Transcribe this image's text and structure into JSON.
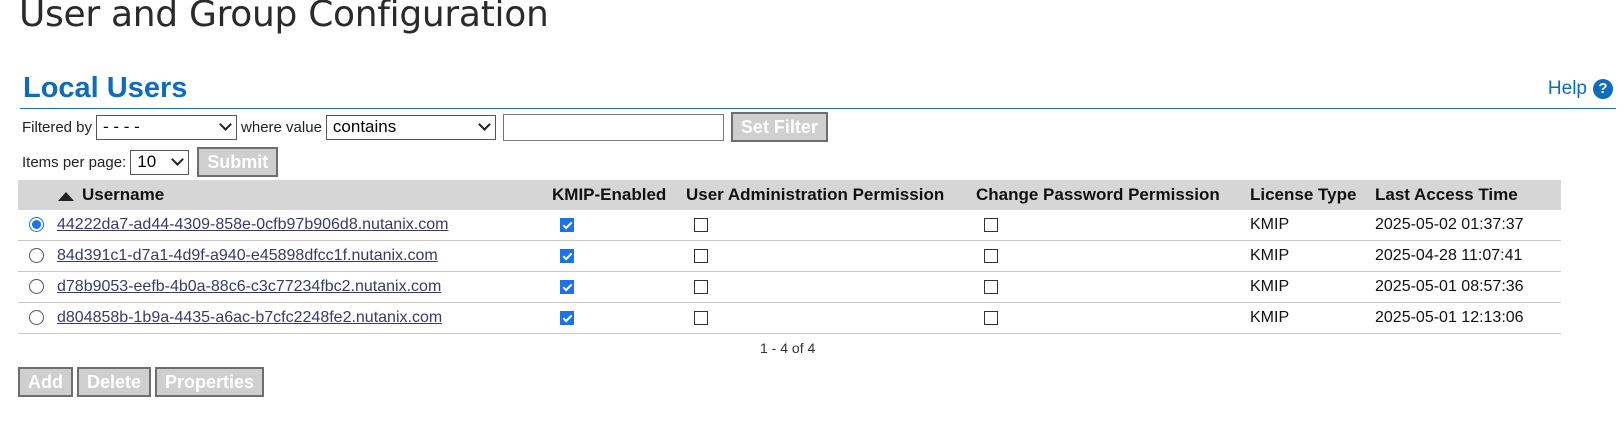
{
  "page": {
    "title": "User and Group Configuration"
  },
  "section": {
    "title": "Local Users",
    "help_label": "Help",
    "help_icon": "?"
  },
  "filter": {
    "filtered_by_label": "Filtered by",
    "filtered_by_value": "- - - -",
    "where_value_label": "where value",
    "condition_value": "contains",
    "text_value": "",
    "set_filter_label": "Set Filter"
  },
  "paging": {
    "items_per_page_label": "Items per page:",
    "items_per_page_value": "10",
    "submit_label": "Submit",
    "range_text": "1 - 4 of 4"
  },
  "table": {
    "sorted_column": "Username",
    "sort_direction": "ascending",
    "columns": {
      "username": "Username",
      "kmip": "KMIP-Enabled",
      "user_admin": "User Administration Permission",
      "change_password": "Change Password Permission",
      "license": "License Type",
      "last_access": "Last Access Time"
    },
    "rows": [
      {
        "selected": true,
        "username": "44222da7-ad44-4309-858e-0cfb97b906d8.nutanix.com",
        "kmip_enabled": true,
        "user_admin": false,
        "change_password": false,
        "license": "KMIP",
        "last_access": "2025-05-02 01:37:37"
      },
      {
        "selected": false,
        "username": "84d391c1-d7a1-4d9f-a940-e45898dfcc1f.nutanix.com",
        "kmip_enabled": true,
        "user_admin": false,
        "change_password": false,
        "license": "KMIP",
        "last_access": "2025-04-28 11:07:41"
      },
      {
        "selected": false,
        "username": "d78b9053-eefb-4b0a-88c6-c3c77234fbc2.nutanix.com",
        "kmip_enabled": true,
        "user_admin": false,
        "change_password": false,
        "license": "KMIP",
        "last_access": "2025-05-01 08:57:36"
      },
      {
        "selected": false,
        "username": "d804858b-1b9a-4435-a6ac-b7cfc2248fe2.nutanix.com",
        "kmip_enabled": true,
        "user_admin": false,
        "change_password": false,
        "license": "KMIP",
        "last_access": "2025-05-01 12:13:06"
      }
    ]
  },
  "actions": {
    "add_label": "Add",
    "delete_label": "Delete",
    "properties_label": "Properties"
  },
  "colors": {
    "brand_blue": "#0f6cbd",
    "header_bg": "#d6d6d6",
    "disabled_button_bg": "#cfcfcf",
    "checkbox_checked": "#1a73e8"
  },
  "icons": {
    "help": "help-circle-icon",
    "sort": "sort-ascending-icon",
    "dropdown": "chevron-down-icon"
  }
}
